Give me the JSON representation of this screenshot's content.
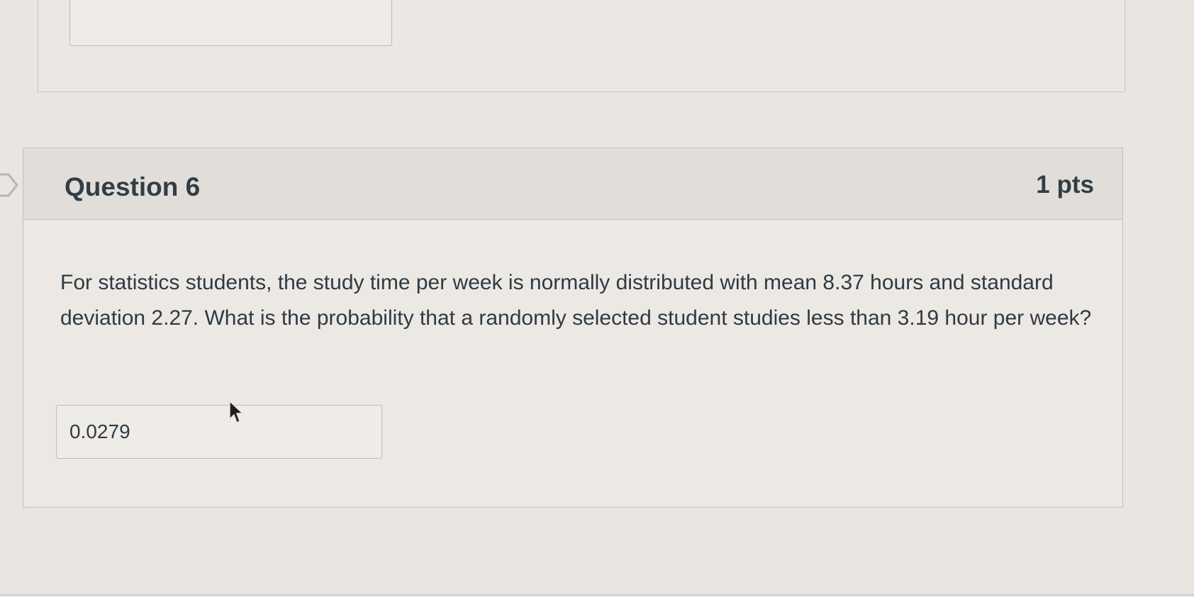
{
  "question": {
    "title": "Question 6",
    "points": "1 pts",
    "text": "For statistics students, the study time per week is normally distributed with mean 8.37 hours and standard deviation 2.27. What is the probability that a randomly selected student studies less than 3.19 hour per week?",
    "answer_value": "0.0279"
  },
  "icons": {
    "flag": "flag-marker-icon",
    "cursor": "mouse-pointer-icon"
  },
  "colors": {
    "page_background": "#e9e6e2",
    "card_background": "#ece9e5",
    "header_background": "#e1deda",
    "text": "#2f3a42"
  }
}
